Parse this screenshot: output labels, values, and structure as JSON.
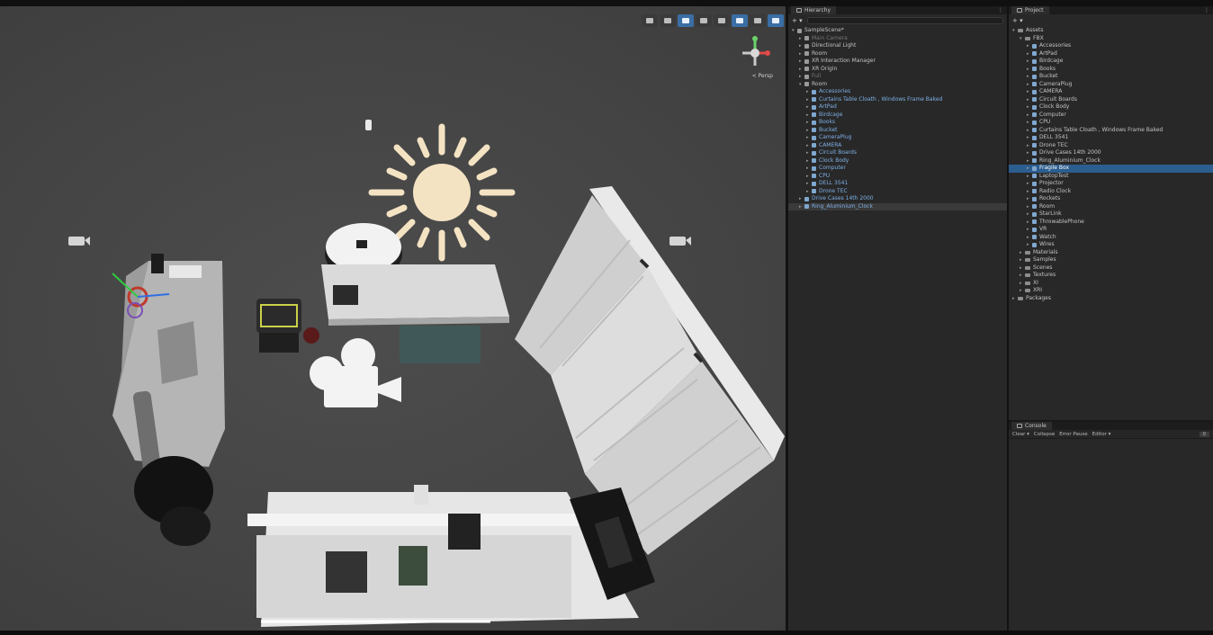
{
  "scene": {
    "gizmo_label": "< Persp",
    "toolbar_buttons": [
      {
        "icon": "gizmo-toggle-icon",
        "active": false
      },
      {
        "icon": "audio-icon",
        "active": false
      },
      {
        "icon": "light-icon",
        "active": true
      },
      {
        "icon": "effects-icon",
        "active": false
      },
      {
        "icon": "visibility-icon",
        "active": false
      },
      {
        "icon": "camera-icon",
        "active": true
      },
      {
        "icon": "gizmos-icon",
        "active": false
      },
      {
        "icon": "globe-icon",
        "active": true
      }
    ]
  },
  "hierarchy": {
    "tab_label": "Hierarchy",
    "add_label": "+ ▾",
    "items": [
      {
        "depth": 0,
        "label": "SampleScene*",
        "kind": "scene",
        "expanded": true
      },
      {
        "depth": 1,
        "label": "Main Camera",
        "kind": "grey",
        "style": "dim"
      },
      {
        "depth": 1,
        "label": "Directional Light",
        "kind": "grey"
      },
      {
        "depth": 1,
        "label": "Room",
        "kind": "grey"
      },
      {
        "depth": 1,
        "label": "XR Interaction Manager",
        "kind": "grey"
      },
      {
        "depth": 1,
        "label": "XR Origin",
        "kind": "grey"
      },
      {
        "depth": 1,
        "label": "Full",
        "kind": "grey",
        "style": "dim"
      },
      {
        "depth": 1,
        "label": "Room",
        "kind": "grey",
        "expanded": true
      },
      {
        "depth": 2,
        "label": "Accessories",
        "kind": "cube",
        "style": "blue"
      },
      {
        "depth": 2,
        "label": "Curtains Table Cloath , Windows Frame Baked",
        "kind": "cube",
        "style": "blue"
      },
      {
        "depth": 2,
        "label": "ArtPad",
        "kind": "cube",
        "style": "blue"
      },
      {
        "depth": 2,
        "label": "Birdcage",
        "kind": "cube",
        "style": "blue"
      },
      {
        "depth": 2,
        "label": "Books",
        "kind": "cube",
        "style": "blue"
      },
      {
        "depth": 2,
        "label": "Bucket",
        "kind": "cube",
        "style": "blue"
      },
      {
        "depth": 2,
        "label": "CameraPlug",
        "kind": "cube",
        "style": "blue"
      },
      {
        "depth": 2,
        "label": "CAMERA",
        "kind": "cube",
        "style": "blue"
      },
      {
        "depth": 2,
        "label": "Circuit Boards",
        "kind": "cube",
        "style": "blue"
      },
      {
        "depth": 2,
        "label": "Clock Body",
        "kind": "cube",
        "style": "blue"
      },
      {
        "depth": 2,
        "label": "Computer",
        "kind": "cube",
        "style": "blue"
      },
      {
        "depth": 2,
        "label": "CPU",
        "kind": "cube",
        "style": "blue"
      },
      {
        "depth": 2,
        "label": "DELL 3541",
        "kind": "cube",
        "style": "blue"
      },
      {
        "depth": 2,
        "label": "Drone TEC",
        "kind": "cube",
        "style": "blue"
      },
      {
        "depth": 1,
        "label": "Drive Cases 14th 2000",
        "kind": "cube",
        "style": "blue"
      },
      {
        "depth": 1,
        "label": "Ring_Aluminium_Clock",
        "kind": "cube",
        "style": "blue",
        "selected": true
      }
    ]
  },
  "project": {
    "tab_label": "Project",
    "add_label": "+ ▾",
    "tree": [
      {
        "depth": 0,
        "label": "Assets",
        "kind": "folder",
        "expanded": true
      },
      {
        "depth": 1,
        "label": "FBX",
        "kind": "folder",
        "expanded": true
      },
      {
        "depth": 2,
        "label": "Accessories",
        "kind": "cube"
      },
      {
        "depth": 2,
        "label": "ArtPad",
        "kind": "cube"
      },
      {
        "depth": 2,
        "label": "Birdcage",
        "kind": "cube"
      },
      {
        "depth": 2,
        "label": "Books",
        "kind": "cube"
      },
      {
        "depth": 2,
        "label": "Bucket",
        "kind": "cube"
      },
      {
        "depth": 2,
        "label": "CameraPlug",
        "kind": "cube"
      },
      {
        "depth": 2,
        "label": "CAMERA",
        "kind": "cube"
      },
      {
        "depth": 2,
        "label": "Circuit Boards",
        "kind": "cube"
      },
      {
        "depth": 2,
        "label": "Clock Body",
        "kind": "cube"
      },
      {
        "depth": 2,
        "label": "Computer",
        "kind": "cube"
      },
      {
        "depth": 2,
        "label": "CPU",
        "kind": "cube"
      },
      {
        "depth": 2,
        "label": "Curtains Table Cloath , Windows Frame Baked",
        "kind": "cube"
      },
      {
        "depth": 2,
        "label": "DELL 3541",
        "kind": "cube"
      },
      {
        "depth": 2,
        "label": "Drone TEC",
        "kind": "cube"
      },
      {
        "depth": 2,
        "label": "Drive Cases 14th 2000",
        "kind": "cube"
      },
      {
        "depth": 2,
        "label": "Ring_Aluminium_Clock",
        "kind": "cube"
      },
      {
        "depth": 2,
        "label": "Fragile Box",
        "kind": "cube",
        "highlight": true
      },
      {
        "depth": 2,
        "label": "LaptopTest",
        "kind": "cube"
      },
      {
        "depth": 2,
        "label": "Projector",
        "kind": "cube"
      },
      {
        "depth": 2,
        "label": "Radio Clock",
        "kind": "cube"
      },
      {
        "depth": 2,
        "label": "Rockets",
        "kind": "cube"
      },
      {
        "depth": 2,
        "label": "Room",
        "kind": "cube"
      },
      {
        "depth": 2,
        "label": "StarLink",
        "kind": "cube"
      },
      {
        "depth": 2,
        "label": "ThrowablePhone",
        "kind": "cube"
      },
      {
        "depth": 2,
        "label": "VR",
        "kind": "cube"
      },
      {
        "depth": 2,
        "label": "Watch",
        "kind": "cube"
      },
      {
        "depth": 2,
        "label": "Wires",
        "kind": "cube"
      },
      {
        "depth": 1,
        "label": "Materials",
        "kind": "folder"
      },
      {
        "depth": 1,
        "label": "Samples",
        "kind": "folder"
      },
      {
        "depth": 1,
        "label": "Scenes",
        "kind": "folder"
      },
      {
        "depth": 1,
        "label": "Textures",
        "kind": "folder"
      },
      {
        "depth": 1,
        "label": "XI",
        "kind": "folder"
      },
      {
        "depth": 1,
        "label": "XRI",
        "kind": "folder"
      },
      {
        "depth": 0,
        "label": "Packages",
        "kind": "folder"
      }
    ]
  },
  "console": {
    "tab_label": "Console",
    "clear_label": "Clear ▾",
    "collapse_label": "Collapse",
    "error_pause_label": "Error Pause",
    "editor_label": "Editor ▾",
    "count_label": "0"
  }
}
